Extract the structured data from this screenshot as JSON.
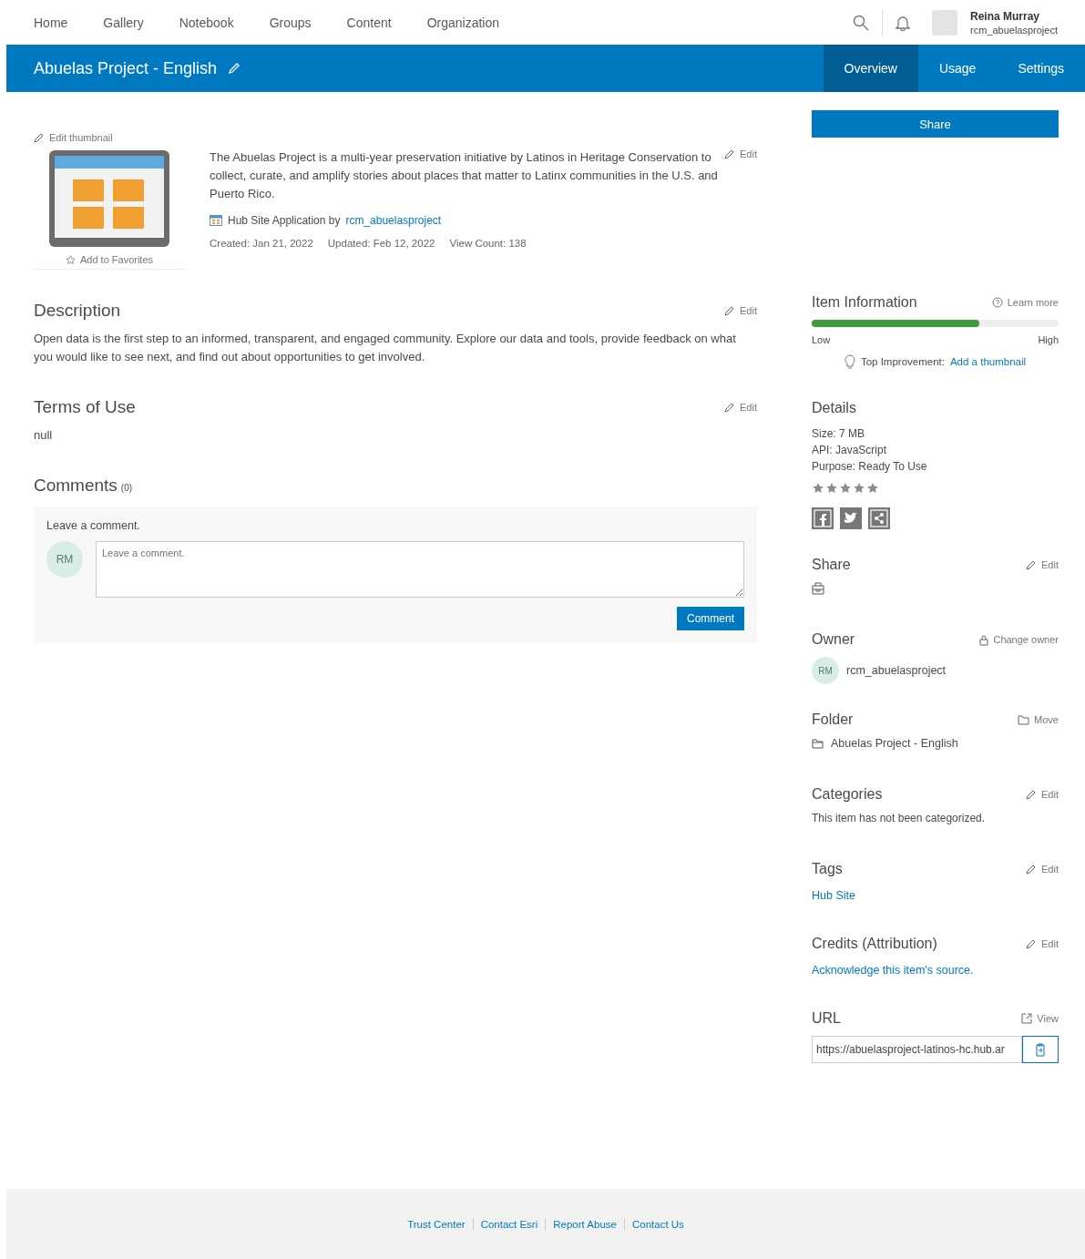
{
  "top_nav": {
    "links": [
      {
        "label": "Home"
      },
      {
        "label": "Gallery"
      },
      {
        "label": "Notebook"
      },
      {
        "label": "Groups"
      },
      {
        "label": "Content"
      },
      {
        "label": "Organization"
      }
    ],
    "user": {
      "name": "Reina Murray",
      "username": "rcm_abuelasproject"
    }
  },
  "title_bar": {
    "title": "Abuelas Project - English",
    "tabs": [
      {
        "label": "Overview",
        "selected": true
      },
      {
        "label": "Usage",
        "selected": false
      },
      {
        "label": "Settings",
        "selected": false
      }
    ]
  },
  "summary": {
    "edit_thumbnail": "Edit thumbnail",
    "add_favorites": "Add to Favorites",
    "text": "The Abuelas Project is a multi-year preservation initiative by Latinos in Heritage Conservation to collect, curate, and amplify stories about places that matter to Latinx communities in the U.S. and Puerto Rico.",
    "edit": "Edit",
    "type_label": "Hub Site Application by",
    "owner_link": "rcm_abuelasproject",
    "meta": [
      "Created: Jan 21, 2022",
      "Updated: Feb 12, 2022",
      "View Count: 138"
    ]
  },
  "description": {
    "title": "Description",
    "edit": "Edit",
    "text": "Open data is the first step to an informed, transparent, and engaged community. Explore our data and tools, provide feedback on what you would like to see next, and find out about opportunities to get involved."
  },
  "terms": {
    "title": "Terms of Use",
    "edit": "Edit",
    "text": "null"
  },
  "comments": {
    "title": "Comments",
    "count": "(0)",
    "label": "Leave a comment.",
    "avatar": "RM",
    "placeholder": "Leave a comment.",
    "button": "Comment"
  },
  "sidebar": {
    "share_button": "Share",
    "item_information": {
      "title": "Item Information",
      "learn_more": "Learn more",
      "level": 0.68,
      "low": "Low",
      "high": "High",
      "tip_label": "Top Improvement:",
      "tip_link": "Add a thumbnail"
    },
    "details": {
      "title": "Details",
      "lines": [
        "Size: 7 MB",
        "API: JavaScript",
        "Purpose: Ready To Use"
      ],
      "stars": 5
    },
    "sections": [
      {
        "kind": "share",
        "title": "Share",
        "action": {
          "kind": "edit",
          "label": "Edit"
        }
      },
      {
        "kind": "owner",
        "title": "Owner",
        "action": {
          "kind": "owner",
          "label": "Change owner"
        },
        "avatar": "RM",
        "value": "rcm_abuelasproject"
      },
      {
        "kind": "folder",
        "title": "Folder",
        "action": {
          "kind": "move",
          "label": "Move"
        },
        "value": "Abuelas Project - English"
      },
      {
        "kind": "text",
        "title": "Categories",
        "action": {
          "kind": "edit",
          "label": "Edit"
        },
        "value": "This item has not been categorized."
      },
      {
        "kind": "link",
        "title": "Tags",
        "action": {
          "kind": "edit",
          "label": "Edit"
        },
        "value": "Hub Site"
      },
      {
        "kind": "link",
        "title": "Credits (Attribution)",
        "action": {
          "kind": "edit",
          "label": "Edit"
        },
        "value": "Acknowledge this item's source."
      },
      {
        "kind": "url",
        "title": "URL",
        "action": {
          "kind": "view",
          "label": "View"
        },
        "value": "https://abuelasproject-latinos-hc.hub.ar"
      }
    ]
  },
  "footer": {
    "links": [
      "Trust Center",
      "Contact Esri",
      "Report Abuse",
      "Contact Us"
    ]
  }
}
